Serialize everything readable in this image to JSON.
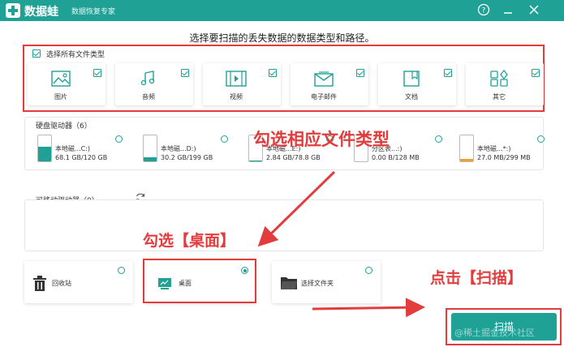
{
  "app": {
    "name": "数据蛙",
    "subtitle": "数据恢复专家",
    "help_icon": "help-icon",
    "minimize_icon": "minimize-icon",
    "close_icon": "close-icon",
    "brand_color": "#1fa196"
  },
  "heading": "选择要扫描的丢失数据的数据类型和路径。",
  "file_types": {
    "select_all_label": "选择所有文件类型",
    "select_all_checked": true,
    "items": [
      {
        "label": "图片",
        "icon": "image-icon",
        "checked": true
      },
      {
        "label": "音频",
        "icon": "music-icon",
        "checked": true
      },
      {
        "label": "视频",
        "icon": "video-icon",
        "checked": true
      },
      {
        "label": "电子邮件",
        "icon": "mail-icon",
        "checked": true
      },
      {
        "label": "文档",
        "icon": "document-icon",
        "checked": true
      },
      {
        "label": "其它",
        "icon": "other-icon",
        "checked": true
      }
    ]
  },
  "hard_drives": {
    "label": "硬盘驱动器（6）",
    "items": [
      {
        "name": "本地磁...C:)",
        "size": "68.1 GB/120 GB",
        "fill": 0.57,
        "color": "#1fa196"
      },
      {
        "name": "本地磁...D:)",
        "size": "30.2 GB/199 GB",
        "fill": 0.15,
        "color": "#1fa196"
      },
      {
        "name": "本地磁...E:)",
        "size": "2.84 GB/78.8 GB",
        "fill": 0.04,
        "color": "#1fa196"
      },
      {
        "name": "分区表...:)",
        "size": "0.00  B/128 MB",
        "fill": 0.0,
        "color": "#f0a030"
      },
      {
        "name": "本地磁...*:)",
        "size": "27.0 MB/299 MB",
        "fill": 0.09,
        "color": "#f0a030"
      }
    ]
  },
  "removable": {
    "label": "可移动驱动器（0）",
    "refresh_icon": "refresh-icon"
  },
  "locations": [
    {
      "label": "回收站",
      "icon": "trash-icon",
      "selected": false
    },
    {
      "label": "桌面",
      "icon": "desktop-icon",
      "selected": true
    },
    {
      "label": "选择文件夹",
      "icon": "folder-icon",
      "selected": false
    }
  ],
  "annotations": {
    "file_type": "勾选相应文件类型",
    "desktop": "勾选【桌面】",
    "scan": "点击【扫描】"
  },
  "scan_button": "扫描",
  "watermark": "@稀土掘金技术社区"
}
